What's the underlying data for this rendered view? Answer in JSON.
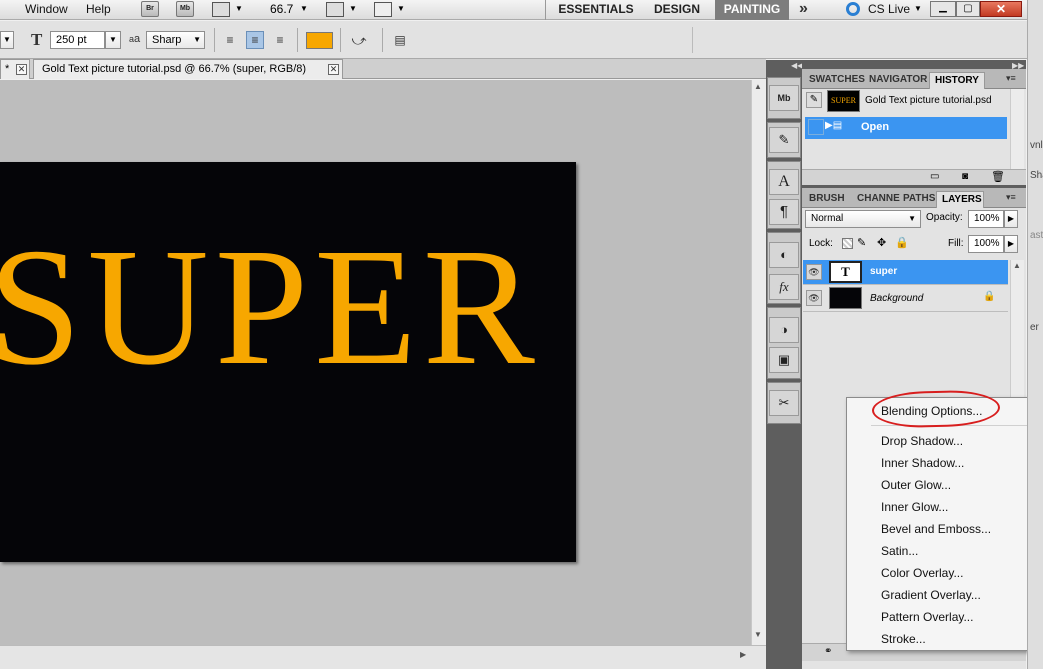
{
  "menubar": {
    "menu_window": "Window",
    "menu_help": "Help",
    "bridge_icon": "Br",
    "minibridge_icon": "Mb",
    "zoom": "66.7",
    "workspaces": [
      "ESSENTIALS",
      "DESIGN",
      "PAINTING"
    ],
    "more": "»",
    "cslive": "CS Live"
  },
  "options": {
    "font_size": "250 pt",
    "aa_label": "a",
    "antialias": "Sharp",
    "text_color": "#f7a700"
  },
  "document": {
    "prev_tab": "*",
    "tab_title": "Gold Text picture tutorial.psd @ 66.7% (super, RGB/8)",
    "canvas_text": "SUPER"
  },
  "history": {
    "tabs": [
      "SWATCHES",
      "NAVIGATOR",
      "HISTORY"
    ],
    "snapshot_label": "Gold Text picture tutorial.psd",
    "snapshot_thumb_text": "SUPER",
    "state_label": "Open"
  },
  "layers": {
    "tabs": [
      "BRUSH F",
      "CHANNE",
      "PATHS",
      "LAYERS"
    ],
    "blend_mode": "Normal",
    "opacity_label": "Opacity:",
    "opacity": "100%",
    "lock_label": "Lock:",
    "fill_label": "Fill:",
    "fill": "100%",
    "items": [
      {
        "name": "super",
        "thumb": "T",
        "selected": true
      },
      {
        "name": "Background",
        "thumb": "",
        "selected": false
      }
    ]
  },
  "context_menu": {
    "items": [
      "Blending Options...",
      "Drop Shadow...",
      "Inner Shadow...",
      "Outer Glow...",
      "Inner Glow...",
      "Bevel and Emboss...",
      "Satin...",
      "Color Overlay...",
      "Gradient Overlay...",
      "Pattern Overlay...",
      "Stroke..."
    ]
  },
  "dock": {
    "icons": [
      "Mb",
      "✎",
      "A",
      "¶",
      "◐",
      "fx",
      "◑",
      "▣",
      "✂"
    ]
  },
  "right_strip": [
    "vnl",
    "Sha",
    "ast",
    "er"
  ],
  "colors": {
    "selection_blue": "#3b95f1",
    "gold": "#f7a700",
    "annotation_red": "#d81e1e"
  }
}
